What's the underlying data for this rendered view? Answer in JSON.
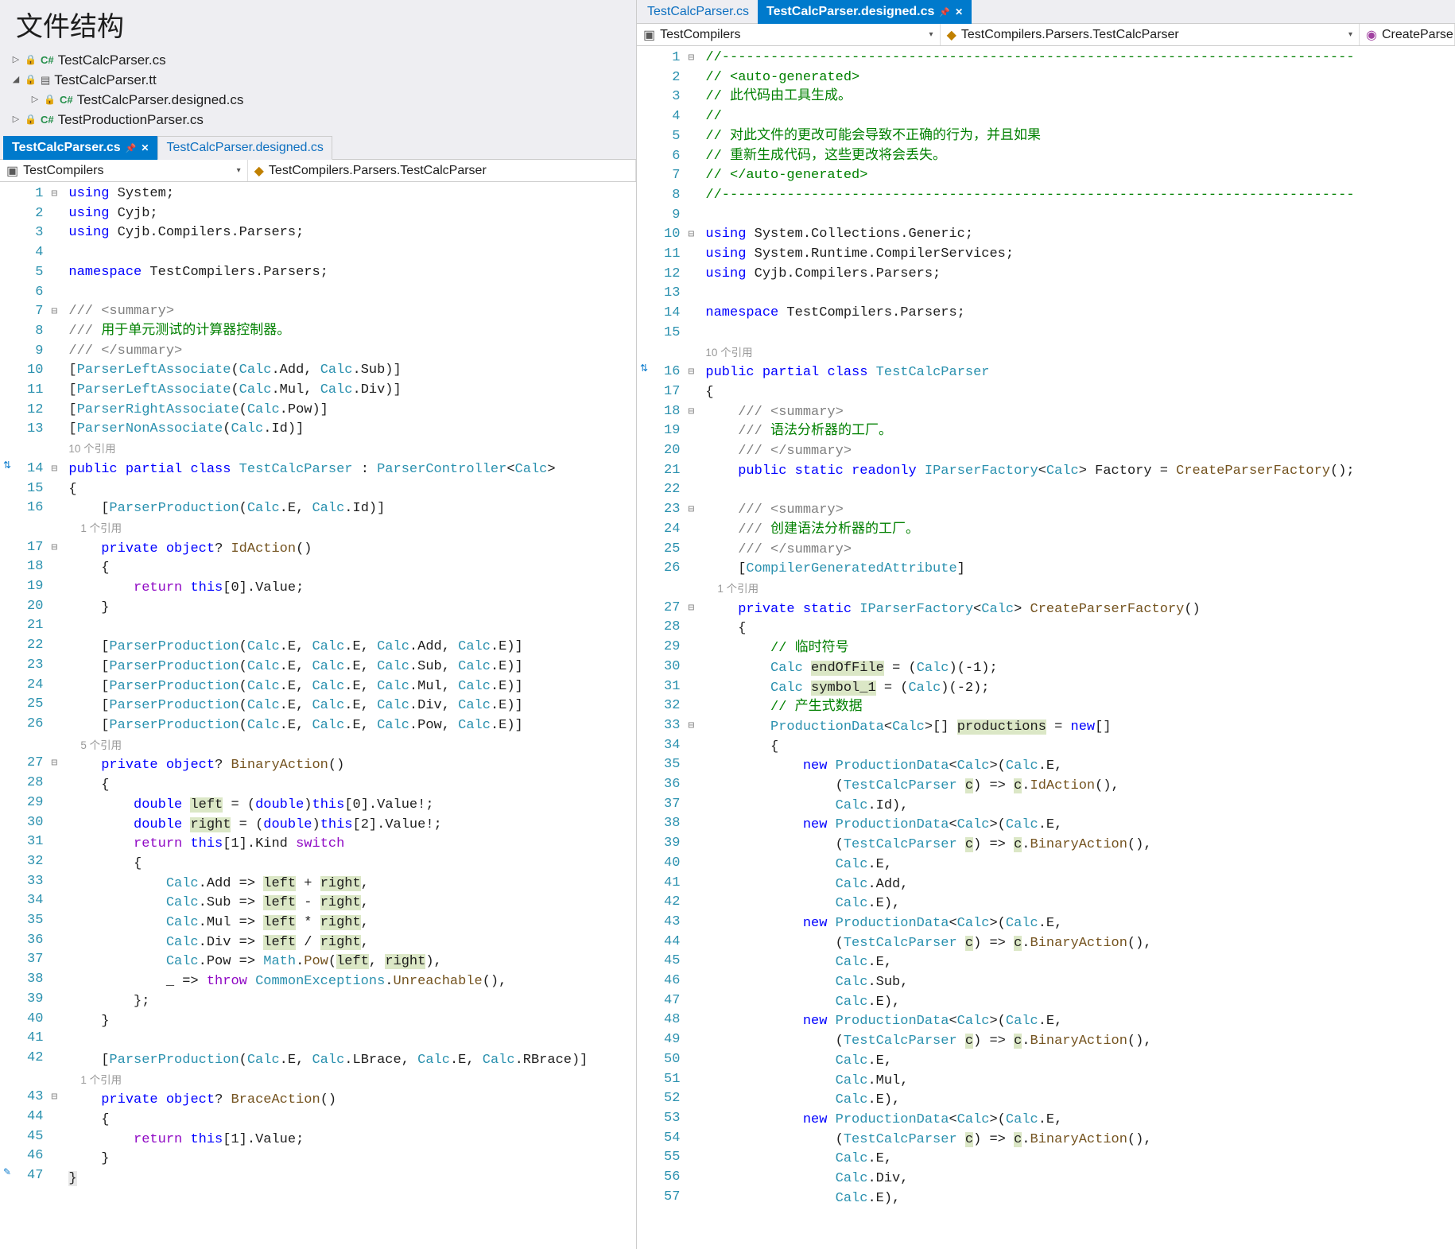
{
  "title": "文件结构",
  "tree": {
    "items": [
      {
        "indent": 0,
        "twisty": "▷",
        "icons": [
          "lock",
          "cs"
        ],
        "name": "TestCalcParser.cs"
      },
      {
        "indent": 0,
        "twisty": "◢",
        "icons": [
          "lock",
          "tt"
        ],
        "name": "TestCalcParser.tt"
      },
      {
        "indent": 1,
        "twisty": "▷",
        "icons": [
          "lock",
          "cs"
        ],
        "name": "TestCalcParser.designed.cs"
      },
      {
        "indent": 0,
        "twisty": "▷",
        "icons": [
          "lock",
          "cs"
        ],
        "name": "TestProductionParser.cs"
      }
    ]
  },
  "left": {
    "tabs": [
      {
        "label": "TestCalcParser.cs",
        "active": true,
        "pinned": true,
        "close": true
      },
      {
        "label": "TestCalcParser.designed.cs",
        "active": false
      }
    ],
    "nav1": "TestCompilers",
    "nav2": "TestCompilers.Parsers.TestCalcParser",
    "lines": [
      {
        "n": 1,
        "fold": "⊟",
        "html": "<span class='tk-key'>using</span> System;"
      },
      {
        "n": 2,
        "html": "<span class='tk-key'>using</span> Cyjb;"
      },
      {
        "n": 3,
        "html": "<span class='tk-key'>using</span> Cyjb.Compilers.Parsers;"
      },
      {
        "n": 4,
        "html": ""
      },
      {
        "n": 5,
        "html": "<span class='tk-key'>namespace</span> TestCompilers.Parsers;"
      },
      {
        "n": 6,
        "html": ""
      },
      {
        "n": 7,
        "fold": "⊟",
        "html": "<span class='tk-doc'>///</span> <span class='tk-doc'>&lt;summary&gt;</span>"
      },
      {
        "n": 8,
        "html": "<span class='tk-doc'>///</span> <span class='tk-com'>用于单元测试的计算器控制器。</span>"
      },
      {
        "n": 9,
        "html": "<span class='tk-doc'>///</span> <span class='tk-doc'>&lt;/summary&gt;</span>"
      },
      {
        "n": 10,
        "html": "[<span class='tk-type'>ParserLeftAssociate</span>(<span class='tk-type'>Calc</span>.Add, <span class='tk-type'>Calc</span>.Sub)]"
      },
      {
        "n": 11,
        "html": "[<span class='tk-type'>ParserLeftAssociate</span>(<span class='tk-type'>Calc</span>.Mul, <span class='tk-type'>Calc</span>.Div)]"
      },
      {
        "n": 12,
        "html": "[<span class='tk-type'>ParserRightAssociate</span>(<span class='tk-type'>Calc</span>.Pow)]"
      },
      {
        "n": 13,
        "html": "[<span class='tk-type'>ParserNonAssociate</span>(<span class='tk-type'>Calc</span>.Id)]"
      },
      {
        "codelens": "10 个引用"
      },
      {
        "n": 14,
        "fold": "⊟",
        "glyph": "sync",
        "html": "<span class='tk-key'>public</span> <span class='tk-key'>partial</span> <span class='tk-key'>class</span> <span class='tk-type'>TestCalcParser</span> : <span class='tk-type'>ParserController</span>&lt;<span class='tk-type'>Calc</span>&gt;"
      },
      {
        "n": 15,
        "html": "{"
      },
      {
        "n": 16,
        "html": "    [<span class='tk-type'>ParserProduction</span>(<span class='tk-type'>Calc</span>.E, <span class='tk-type'>Calc</span>.Id)]"
      },
      {
        "codelens": "    1 个引用"
      },
      {
        "n": 17,
        "fold": "⊟",
        "html": "    <span class='tk-key'>private</span> <span class='tk-key'>object</span>? <span class='tk-brown'>IdAction</span>()"
      },
      {
        "n": 18,
        "html": "    {"
      },
      {
        "n": 19,
        "html": "        <span class='tk-purple'>return</span> <span class='tk-key'>this</span>[0].Value;"
      },
      {
        "n": 20,
        "html": "    }"
      },
      {
        "n": 21,
        "html": ""
      },
      {
        "n": 22,
        "html": "    [<span class='tk-type'>ParserProduction</span>(<span class='tk-type'>Calc</span>.E, <span class='tk-type'>Calc</span>.E, <span class='tk-type'>Calc</span>.Add, <span class='tk-type'>Calc</span>.E)]"
      },
      {
        "n": 23,
        "html": "    [<span class='tk-type'>ParserProduction</span>(<span class='tk-type'>Calc</span>.E, <span class='tk-type'>Calc</span>.E, <span class='tk-type'>Calc</span>.Sub, <span class='tk-type'>Calc</span>.E)]"
      },
      {
        "n": 24,
        "html": "    [<span class='tk-type'>ParserProduction</span>(<span class='tk-type'>Calc</span>.E, <span class='tk-type'>Calc</span>.E, <span class='tk-type'>Calc</span>.Mul, <span class='tk-type'>Calc</span>.E)]"
      },
      {
        "n": 25,
        "html": "    [<span class='tk-type'>ParserProduction</span>(<span class='tk-type'>Calc</span>.E, <span class='tk-type'>Calc</span>.E, <span class='tk-type'>Calc</span>.Div, <span class='tk-type'>Calc</span>.E)]"
      },
      {
        "n": 26,
        "html": "    [<span class='tk-type'>ParserProduction</span>(<span class='tk-type'>Calc</span>.E, <span class='tk-type'>Calc</span>.E, <span class='tk-type'>Calc</span>.Pow, <span class='tk-type'>Calc</span>.E)]"
      },
      {
        "codelens": "    5 个引用"
      },
      {
        "n": 27,
        "fold": "⊟",
        "html": "    <span class='tk-key'>private</span> <span class='tk-key'>object</span>? <span class='tk-brown'>BinaryAction</span>()"
      },
      {
        "n": 28,
        "html": "    {"
      },
      {
        "n": 29,
        "html": "        <span class='tk-key'>double</span> <span class='hilite'>left</span> = (<span class='tk-key'>double</span>)<span class='tk-key'>this</span>[0].Value!;"
      },
      {
        "n": 30,
        "html": "        <span class='tk-key'>double</span> <span class='hilite'>right</span> = (<span class='tk-key'>double</span>)<span class='tk-key'>this</span>[2].Value!;"
      },
      {
        "n": 31,
        "html": "        <span class='tk-purple'>return</span> <span class='tk-key'>this</span>[1].Kind <span class='tk-purple'>switch</span>"
      },
      {
        "n": 32,
        "html": "        {"
      },
      {
        "n": 33,
        "html": "            <span class='tk-type'>Calc</span>.Add =&gt; <span class='hilite'>left</span> + <span class='hilite'>right</span>,"
      },
      {
        "n": 34,
        "html": "            <span class='tk-type'>Calc</span>.Sub =&gt; <span class='hilite'>left</span> - <span class='hilite'>right</span>,"
      },
      {
        "n": 35,
        "html": "            <span class='tk-type'>Calc</span>.Mul =&gt; <span class='hilite'>left</span> * <span class='hilite'>right</span>,"
      },
      {
        "n": 36,
        "html": "            <span class='tk-type'>Calc</span>.Div =&gt; <span class='hilite'>left</span> / <span class='hilite'>right</span>,"
      },
      {
        "n": 37,
        "html": "            <span class='tk-type'>Calc</span>.Pow =&gt; <span class='tk-type'>Math</span>.<span class='tk-brown'>Pow</span>(<span class='hilite'>left</span>, <span class='hilite'>right</span>),"
      },
      {
        "n": 38,
        "html": "            _ =&gt; <span class='tk-purple'>throw</span> <span class='tk-type'>CommonExceptions</span>.<span class='tk-brown'>Unreachable</span>(),"
      },
      {
        "n": 39,
        "html": "        };"
      },
      {
        "n": 40,
        "html": "    }"
      },
      {
        "n": 41,
        "html": ""
      },
      {
        "n": 42,
        "html": "    [<span class='tk-type'>ParserProduction</span>(<span class='tk-type'>Calc</span>.E, <span class='tk-type'>Calc</span>.LBrace, <span class='tk-type'>Calc</span>.E, <span class='tk-type'>Calc</span>.RBrace)]"
      },
      {
        "codelens": "    1 个引用"
      },
      {
        "n": 43,
        "fold": "⊟",
        "html": "    <span class='tk-key'>private</span> <span class='tk-key'>object</span>? <span class='tk-brown'>BraceAction</span>()"
      },
      {
        "n": 44,
        "html": "    {"
      },
      {
        "n": 45,
        "html": "        <span class='tk-purple'>return</span> <span class='tk-key'>this</span>[1].Value;"
      },
      {
        "n": 46,
        "html": "    }"
      },
      {
        "n": 47,
        "glyph": "pencil",
        "html": "<span style='background:#e8e8e8;'>}</span>"
      }
    ]
  },
  "right": {
    "tabs": [
      {
        "label": "TestCalcParser.cs",
        "active": false
      },
      {
        "label": "TestCalcParser.designed.cs",
        "active": true,
        "pinned": true,
        "close": true
      }
    ],
    "nav1": "TestCompilers",
    "nav2": "TestCompilers.Parsers.TestCalcParser",
    "nav3": "CreateParse",
    "lines": [
      {
        "n": 1,
        "fold": "⊟",
        "html": "<span class='tk-com'>//------------------------------------------------------------------------------</span>"
      },
      {
        "n": 2,
        "html": "<span class='tk-com'>// &lt;auto-generated&gt;</span>"
      },
      {
        "n": 3,
        "html": "<span class='tk-com'>// 此代码由工具生成。</span>"
      },
      {
        "n": 4,
        "html": "<span class='tk-com'>//</span>"
      },
      {
        "n": 5,
        "html": "<span class='tk-com'>// 对此文件的更改可能会导致不正确的行为，并且如果</span>"
      },
      {
        "n": 6,
        "html": "<span class='tk-com'>// 重新生成代码，这些更改将会丢失。</span>"
      },
      {
        "n": 7,
        "html": "<span class='tk-com'>// &lt;/auto-generated&gt;</span>"
      },
      {
        "n": 8,
        "html": "<span class='tk-com'>//------------------------------------------------------------------------------</span>"
      },
      {
        "n": 9,
        "html": ""
      },
      {
        "n": 10,
        "fold": "⊟",
        "html": "<span class='tk-key'>using</span> System.Collections.Generic;"
      },
      {
        "n": 11,
        "html": "<span class='tk-key'>using</span> System.Runtime.CompilerServices;"
      },
      {
        "n": 12,
        "html": "<span class='tk-key'>using</span> Cyjb.Compilers.Parsers;"
      },
      {
        "n": 13,
        "html": ""
      },
      {
        "n": 14,
        "html": "<span class='tk-key'>namespace</span> TestCompilers.Parsers;"
      },
      {
        "n": 15,
        "html": ""
      },
      {
        "codelens": "10 个引用"
      },
      {
        "n": 16,
        "fold": "⊟",
        "glyph": "sync",
        "html": "<span class='tk-key'>public</span> <span class='tk-key'>partial</span> <span class='tk-key'>class</span> <span class='tk-type'>TestCalcParser</span>"
      },
      {
        "n": 17,
        "html": "{"
      },
      {
        "n": 18,
        "fold": "⊟",
        "html": "    <span class='tk-doc'>/// &lt;summary&gt;</span>"
      },
      {
        "n": 19,
        "html": "    <span class='tk-doc'>///</span> <span class='tk-com'>语法分析器的工厂。</span>"
      },
      {
        "n": 20,
        "html": "    <span class='tk-doc'>/// &lt;/summary&gt;</span>"
      },
      {
        "n": 21,
        "html": "    <span class='tk-key'>public</span> <span class='tk-key'>static</span> <span class='tk-key'>readonly</span> <span class='tk-type'>IParserFactory</span>&lt;<span class='tk-type'>Calc</span>&gt; Factory = <span class='tk-brown'>CreateParserFactory</span>();"
      },
      {
        "n": 22,
        "html": ""
      },
      {
        "n": 23,
        "fold": "⊟",
        "html": "    <span class='tk-doc'>/// &lt;summary&gt;</span>"
      },
      {
        "n": 24,
        "html": "    <span class='tk-doc'>///</span> <span class='tk-com'>创建语法分析器的工厂。</span>"
      },
      {
        "n": 25,
        "html": "    <span class='tk-doc'>/// &lt;/summary&gt;</span>"
      },
      {
        "n": 26,
        "html": "    [<span class='tk-type'>CompilerGeneratedAttribute</span>]"
      },
      {
        "codelens": "    1 个引用"
      },
      {
        "n": 27,
        "fold": "⊟",
        "html": "    <span class='tk-key'>private</span> <span class='tk-key'>static</span> <span class='tk-type'>IParserFactory</span>&lt;<span class='tk-type'>Calc</span>&gt; <span class='tk-brown'>CreateParserFactory</span>()"
      },
      {
        "n": 28,
        "html": "    {"
      },
      {
        "n": 29,
        "html": "        <span class='tk-com'>// 临时符号</span>"
      },
      {
        "n": 30,
        "html": "        <span class='tk-type'>Calc</span> <span class='hilite'>endOfFile</span> = (<span class='tk-type'>Calc</span>)(-1);"
      },
      {
        "n": 31,
        "html": "        <span class='tk-type'>Calc</span> <span class='hilite'>symbol_1</span> = (<span class='tk-type'>Calc</span>)(-2);"
      },
      {
        "n": 32,
        "html": "        <span class='tk-com'>// 产生式数据</span>"
      },
      {
        "n": 33,
        "fold": "⊟",
        "html": "        <span class='tk-type'>ProductionData</span>&lt;<span class='tk-type'>Calc</span>&gt;[] <span class='hilite'>productions</span> = <span class='tk-key'>new</span>[]"
      },
      {
        "n": 34,
        "html": "        {"
      },
      {
        "n": 35,
        "html": "            <span class='tk-key'>new</span> <span class='tk-type'>ProductionData</span>&lt;<span class='tk-type'>Calc</span>&gt;(<span class='tk-type'>Calc</span>.E,"
      },
      {
        "n": 36,
        "html": "                (<span class='tk-type'>TestCalcParser</span> <span class='hilite'>c</span>) =&gt; <span class='hilite'>c</span>.<span class='tk-brown'>IdAction</span>(),"
      },
      {
        "n": 37,
        "html": "                <span class='tk-type'>Calc</span>.Id),"
      },
      {
        "n": 38,
        "html": "            <span class='tk-key'>new</span> <span class='tk-type'>ProductionData</span>&lt;<span class='tk-type'>Calc</span>&gt;(<span class='tk-type'>Calc</span>.E,"
      },
      {
        "n": 39,
        "html": "                (<span class='tk-type'>TestCalcParser</span> <span class='hilite'>c</span>) =&gt; <span class='hilite'>c</span>.<span class='tk-brown'>BinaryAction</span>(),"
      },
      {
        "n": 40,
        "html": "                <span class='tk-type'>Calc</span>.E,"
      },
      {
        "n": 41,
        "html": "                <span class='tk-type'>Calc</span>.Add,"
      },
      {
        "n": 42,
        "html": "                <span class='tk-type'>Calc</span>.E),"
      },
      {
        "n": 43,
        "html": "            <span class='tk-key'>new</span> <span class='tk-type'>ProductionData</span>&lt;<span class='tk-type'>Calc</span>&gt;(<span class='tk-type'>Calc</span>.E,"
      },
      {
        "n": 44,
        "html": "                (<span class='tk-type'>TestCalcParser</span> <span class='hilite'>c</span>) =&gt; <span class='hilite'>c</span>.<span class='tk-brown'>BinaryAction</span>(),"
      },
      {
        "n": 45,
        "html": "                <span class='tk-type'>Calc</span>.E,"
      },
      {
        "n": 46,
        "html": "                <span class='tk-type'>Calc</span>.Sub,"
      },
      {
        "n": 47,
        "html": "                <span class='tk-type'>Calc</span>.E),"
      },
      {
        "n": 48,
        "html": "            <span class='tk-key'>new</span> <span class='tk-type'>ProductionData</span>&lt;<span class='tk-type'>Calc</span>&gt;(<span class='tk-type'>Calc</span>.E,"
      },
      {
        "n": 49,
        "html": "                (<span class='tk-type'>TestCalcParser</span> <span class='hilite'>c</span>) =&gt; <span class='hilite'>c</span>.<span class='tk-brown'>BinaryAction</span>(),"
      },
      {
        "n": 50,
        "html": "                <span class='tk-type'>Calc</span>.E,"
      },
      {
        "n": 51,
        "html": "                <span class='tk-type'>Calc</span>.Mul,"
      },
      {
        "n": 52,
        "html": "                <span class='tk-type'>Calc</span>.E),"
      },
      {
        "n": 53,
        "html": "            <span class='tk-key'>new</span> <span class='tk-type'>ProductionData</span>&lt;<span class='tk-type'>Calc</span>&gt;(<span class='tk-type'>Calc</span>.E,"
      },
      {
        "n": 54,
        "html": "                (<span class='tk-type'>TestCalcParser</span> <span class='hilite'>c</span>) =&gt; <span class='hilite'>c</span>.<span class='tk-brown'>BinaryAction</span>(),"
      },
      {
        "n": 55,
        "html": "                <span class='tk-type'>Calc</span>.E,"
      },
      {
        "n": 56,
        "html": "                <span class='tk-type'>Calc</span>.Div,"
      },
      {
        "n": 57,
        "html": "                <span class='tk-type'>Calc</span>.E),"
      }
    ]
  }
}
